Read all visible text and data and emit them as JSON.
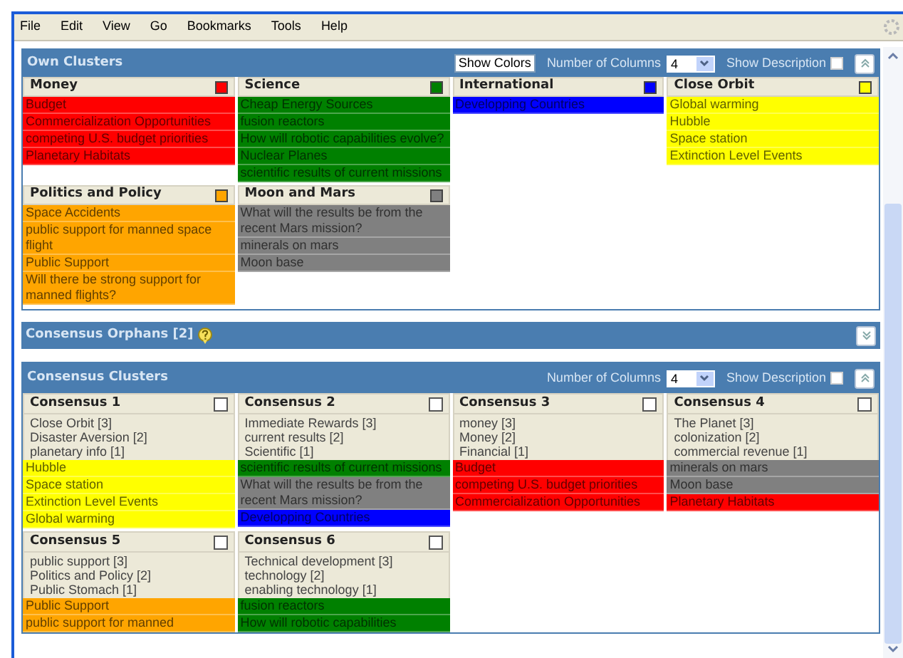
{
  "menu": [
    "File",
    "Edit",
    "View",
    "Go",
    "Bookmarks",
    "Tools",
    "Help"
  ],
  "own_clusters": {
    "title": "Own Clusters",
    "show_colors_button": "Show Colors",
    "columns_label": "Number of Columns",
    "columns_value": "4",
    "show_description_label": "Show Description",
    "show_description": false,
    "clusters": [
      {
        "name": "Money",
        "color": "#ff0000",
        "items": [
          {
            "text": "Budget",
            "color": "#ff0000"
          },
          {
            "text": "Commercialization Opportunities",
            "color": "#ff0000"
          },
          {
            "text": "competing U.S. budget priorities",
            "color": "#ff0000"
          },
          {
            "text": "Planetary Habitats",
            "color": "#ff0000"
          }
        ]
      },
      {
        "name": "Science",
        "color": "#008000",
        "items": [
          {
            "text": "Cheap Energy Sources",
            "color": "#008000"
          },
          {
            "text": "fusion reactors",
            "color": "#008000"
          },
          {
            "text": "How will robotic capabilities evolve?",
            "color": "#008000"
          },
          {
            "text": "Nuclear Planes",
            "color": "#008000"
          },
          {
            "text": "scientific results of current missions",
            "color": "#008000"
          }
        ]
      },
      {
        "name": "International",
        "color": "#0000ff",
        "items": [
          {
            "text": "Developping Countries",
            "color": "#0000ff"
          }
        ]
      },
      {
        "name": "Close Orbit",
        "color": "#ffff00",
        "items": [
          {
            "text": "Global warming",
            "color": "#ffff00"
          },
          {
            "text": "Hubble",
            "color": "#ffff00"
          },
          {
            "text": "Space station",
            "color": "#ffff00"
          },
          {
            "text": "Extinction Level Events",
            "color": "#ffff00"
          }
        ]
      },
      {
        "name": "Politics and Policy",
        "color": "#ffa500",
        "items": [
          {
            "text": "Space Accidents",
            "color": "#ffa500"
          },
          {
            "text": "public support for manned space flight",
            "color": "#ffa500"
          },
          {
            "text": "Public Support",
            "color": "#ffa500"
          },
          {
            "text": "Will there be strong support for manned flights?",
            "color": "#ffa500"
          }
        ]
      },
      {
        "name": "Moon and Mars",
        "color": "#808080",
        "items": [
          {
            "text": "What will the results be from the recent Mars mission?",
            "color": "#808080"
          },
          {
            "text": "minerals on mars",
            "color": "#808080"
          },
          {
            "text": "Moon base",
            "color": "#808080"
          }
        ]
      }
    ]
  },
  "consensus_orphans": {
    "title": "Consensus Orphans [2]"
  },
  "consensus_clusters": {
    "title": "Consensus Clusters",
    "columns_label": "Number of Columns",
    "columns_value": "4",
    "show_description_label": "Show Description",
    "show_description": false,
    "clusters": [
      {
        "name": "Consensus 1",
        "checked": false,
        "descriptions": [
          "Close Orbit [3]",
          "Disaster Aversion [2]",
          "planetary info [1]"
        ],
        "items": [
          {
            "text": "Hubble",
            "color": "#ffff00"
          },
          {
            "text": "Space station",
            "color": "#ffff00"
          },
          {
            "text": "Extinction Level Events",
            "color": "#ffff00"
          },
          {
            "text": "Global warming",
            "color": "#ffff00"
          }
        ]
      },
      {
        "name": "Consensus 2",
        "checked": false,
        "descriptions": [
          "Immediate Rewards [3]",
          "current results [2]",
          "Scientific [1]"
        ],
        "items": [
          {
            "text": "scientific results of current missions",
            "color": "#008000"
          },
          {
            "text": "What will the results be from the recent Mars mission?",
            "color": "#808080"
          },
          {
            "text": "Developping Countries",
            "color": "#0000ff"
          }
        ]
      },
      {
        "name": "Consensus 3",
        "checked": false,
        "descriptions": [
          "money [3]",
          "Money [2]",
          "Financial [1]"
        ],
        "items": [
          {
            "text": "Budget",
            "color": "#ff0000"
          },
          {
            "text": "competing U.S. budget priorities",
            "color": "#ff0000"
          },
          {
            "text": "Commercialization Opportunities",
            "color": "#ff0000"
          }
        ]
      },
      {
        "name": "Consensus 4",
        "checked": false,
        "descriptions": [
          "The Planet [3]",
          "colonization [2]",
          "commercial revenue [1]"
        ],
        "items": [
          {
            "text": "minerals on mars",
            "color": "#808080"
          },
          {
            "text": "Moon base",
            "color": "#808080"
          },
          {
            "text": "Planetary Habitats",
            "color": "#ff0000"
          }
        ]
      },
      {
        "name": "Consensus 5",
        "checked": false,
        "descriptions": [
          "public support [3]",
          "Politics and Policy [2]",
          "Public Stomach [1]"
        ],
        "items": [
          {
            "text": "Public Support",
            "color": "#ffa500"
          },
          {
            "text": "public support for manned",
            "color": "#ffa500"
          }
        ]
      },
      {
        "name": "Consensus 6",
        "checked": false,
        "descriptions": [
          "Technical development [3]",
          "technology [2]",
          "enabling technology [1]"
        ],
        "items": [
          {
            "text": "fusion reactors",
            "color": "#008000"
          },
          {
            "text": "How will robotic capabilities",
            "color": "#008000"
          }
        ]
      }
    ]
  }
}
